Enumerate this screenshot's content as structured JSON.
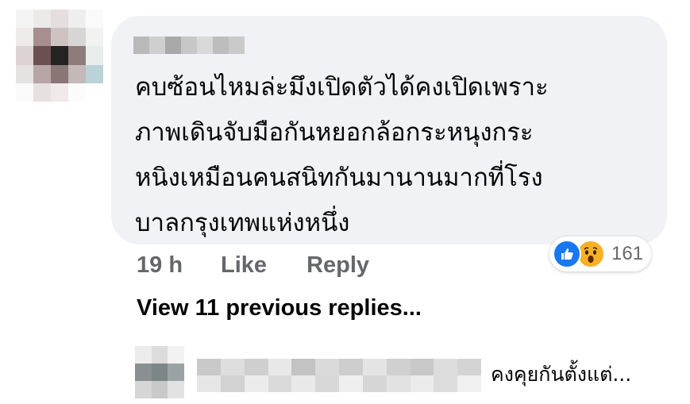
{
  "comment": {
    "text_lines": [
      "คบซ้อนไหมล่ะมึงเปิดตัวได้คงเปิดเพราะ",
      "ภาพเดินจับมือกันหยอกล้อกระหนุงกระ",
      "หนิงเหมือนคนสนิทกันมานานมากที่โรง",
      "บาลกรุงเทพแห่งหนึ่ง"
    ],
    "timestamp": "19 h",
    "like_label": "Like",
    "reply_label": "Reply",
    "reactions": {
      "icons": [
        "like-icon",
        "wow-icon"
      ],
      "count": "161"
    }
  },
  "view_previous_label": "View 11 previous replies...",
  "reply_preview": {
    "text": "คงคุยกันตั้งแต่..."
  },
  "colors": {
    "bubble": "#f0f2f5",
    "secondary_text": "#65676b",
    "primary_text": "#050505",
    "like_blue": "#1877f2",
    "wow_yellow": "#f7b125"
  }
}
